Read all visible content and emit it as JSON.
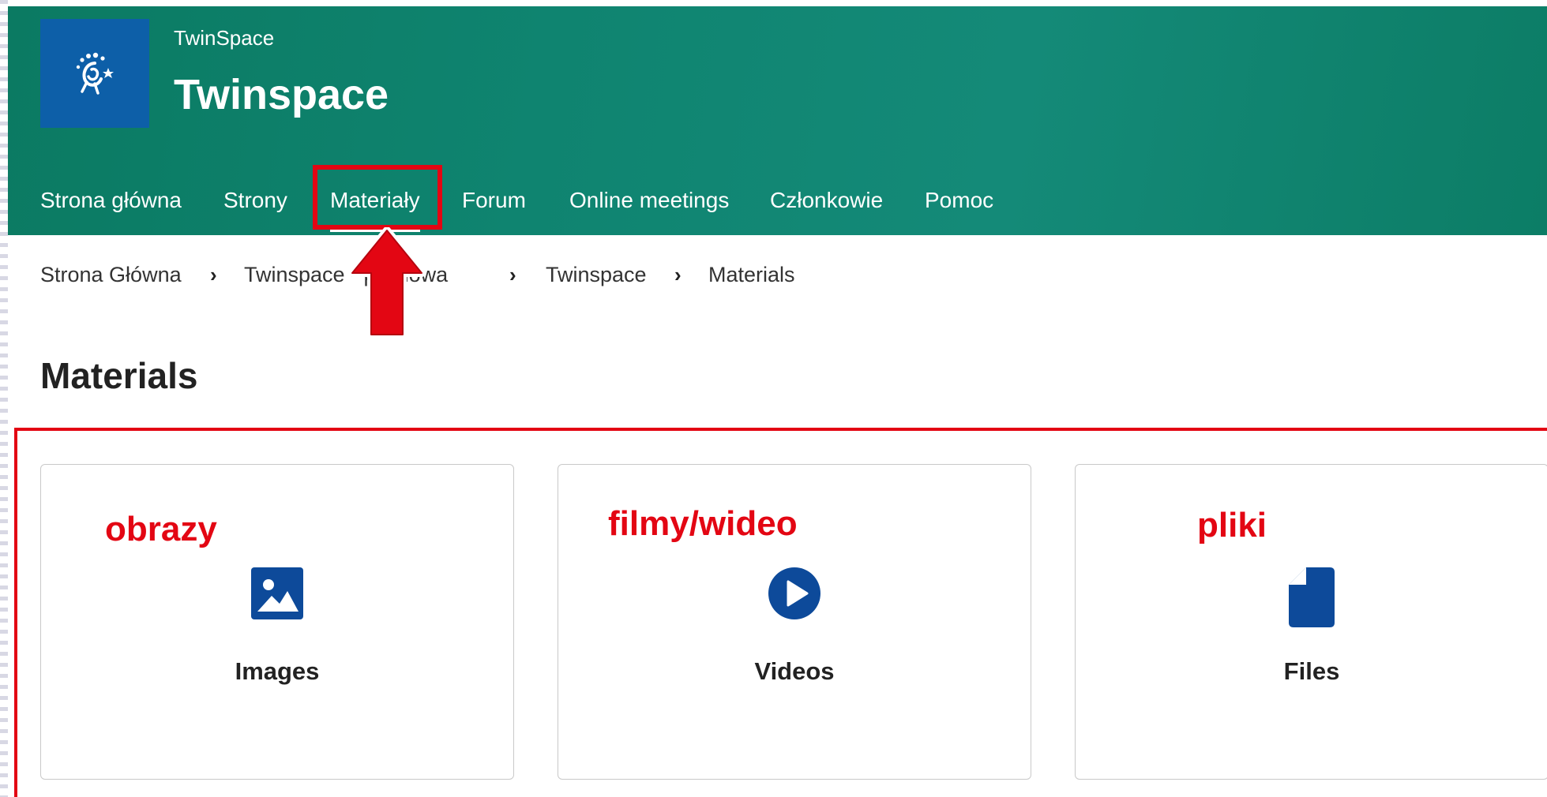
{
  "colors": {
    "header_green": "#0f8470",
    "logo_blue": "#0d5fa8",
    "icon_blue": "#0d4a9a",
    "highlight_red": "#e30613"
  },
  "header": {
    "kicker": "TwinSpace",
    "title": "Twinspace",
    "logo_icon": "twinning-stars-logo-icon"
  },
  "nav": {
    "items": [
      {
        "label": "Strona główna"
      },
      {
        "label": "Strony"
      },
      {
        "label": "Materiały",
        "active": true
      },
      {
        "label": "Forum"
      },
      {
        "label": "Online meetings"
      },
      {
        "label": "Członkowie"
      },
      {
        "label": "Pomoc"
      }
    ]
  },
  "breadcrumb": {
    "items": [
      "Strona Główna",
      "Twinspace - pieniowa",
      "Twinspace",
      "Materials"
    ]
  },
  "page": {
    "title": "Materials"
  },
  "cards": [
    {
      "label": "Images",
      "icon": "image-icon",
      "annotation": "obrazy"
    },
    {
      "label": "Videos",
      "icon": "play-circle-icon",
      "annotation": "filmy/wideo"
    },
    {
      "label": "Files",
      "icon": "file-icon",
      "annotation": "pliki"
    }
  ]
}
